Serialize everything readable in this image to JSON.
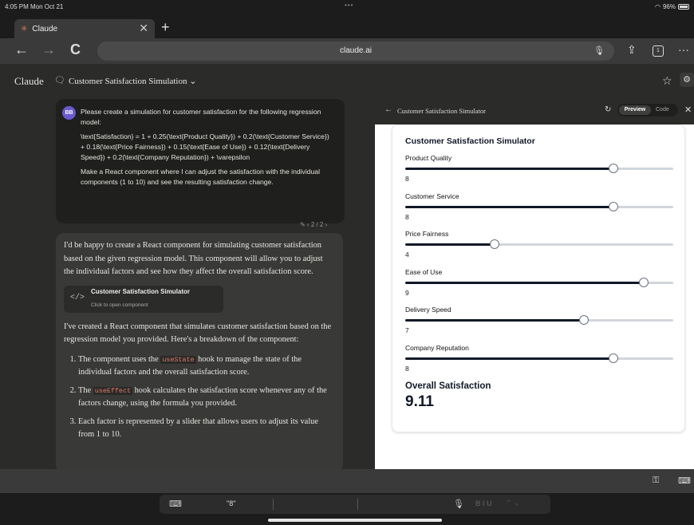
{
  "status": {
    "time": "4:05 PM  Mon Oct 21",
    "dots": "•••",
    "battery": "96%"
  },
  "tab": {
    "favicon": "✳",
    "title": "Claude",
    "close": "✕",
    "new_tab": "+"
  },
  "nav": {
    "back": "←",
    "forward": "→",
    "reload": "C",
    "url": "claude.ai",
    "mic": "🎙",
    "share": "⇪",
    "tab_count": "1",
    "more": "···"
  },
  "header": {
    "brand": "Claude",
    "chat_icon": "🗨",
    "chat_title": "Customer Satisfaction Simulation ⌄",
    "star": "☆",
    "settings": "⚙"
  },
  "user_message": {
    "avatar": "BB",
    "paragraphs": [
      "Please create a simulation for customer satisfaction for the following regression model:",
      "\\text{Satisfaction} = 1 + 0.25(\\text{Product Quality}) + 0.2(\\text{Customer Service}) + 0.18(\\text{Price Fairness}) + 0.15(\\text{Ease of Use}) + 0.12(\\text{Delivery Speed}) + 0.2(\\text{Company Reputation}) + \\varepsilon",
      "Make a React component where I can adjust the satisfaction with the individual components (1 to 10) and see the resulting satisfaction change."
    ],
    "meta": "✎  ‹ 2 / 2 ›"
  },
  "assistant": {
    "intro": "I'd be happy to create a React component for simulating customer satisfaction based on the given regression model. This component will allow you to adjust the individual factors and see how they affect the overall satisfaction score.",
    "artifact_icon": "</>",
    "artifact_title": "Customer Satisfaction Simulator",
    "artifact_sub": "Click to open component",
    "para2": "I've created a React component that simulates customer satisfaction based on the regression model you provided. Here's a breakdown of the component:",
    "li1_a": "The component uses the ",
    "li1_code": "useState",
    "li1_b": " hook to manage the state of the individual factors and the overall satisfaction score.",
    "li2_a": "The ",
    "li2_code": "useEffect",
    "li2_b": " hook calculates the satisfaction score whenever any of the factors change, using the formula you provided.",
    "li3": "Each factor is represented by a slider that allows users to adjust its value from 1 to 10."
  },
  "panel": {
    "back": "←",
    "title": "Customer Satisfaction Simulator",
    "refresh": "↻",
    "preview": "Preview",
    "code": "Code",
    "close": "✕",
    "card_title": "Customer Satisfaction Simulator",
    "factors": [
      {
        "label": "Product Quality",
        "value": "8",
        "level": 0.7778
      },
      {
        "label": "Customer Service",
        "value": "8",
        "level": 0.7778
      },
      {
        "label": "Price Fairness",
        "value": "4",
        "level": 0.3333
      },
      {
        "label": "Ease of Use",
        "value": "9",
        "level": 0.8889
      },
      {
        "label": "Delivery Speed",
        "value": "7",
        "level": 0.6667
      },
      {
        "label": "Company Reputation",
        "value": "8",
        "level": 0.7778
      }
    ],
    "overall_label": "Overall Satisfaction",
    "overall_score": "9.11"
  },
  "accessory": {
    "key_icon": "⚿",
    "keyboard_icon": "⌨"
  },
  "keyboard": {
    "kbd_icon": "⌨",
    "suggestion": "\"8\"",
    "mic": "🎙",
    "format": "B I U",
    "arrows": "⌃  ⌄"
  }
}
